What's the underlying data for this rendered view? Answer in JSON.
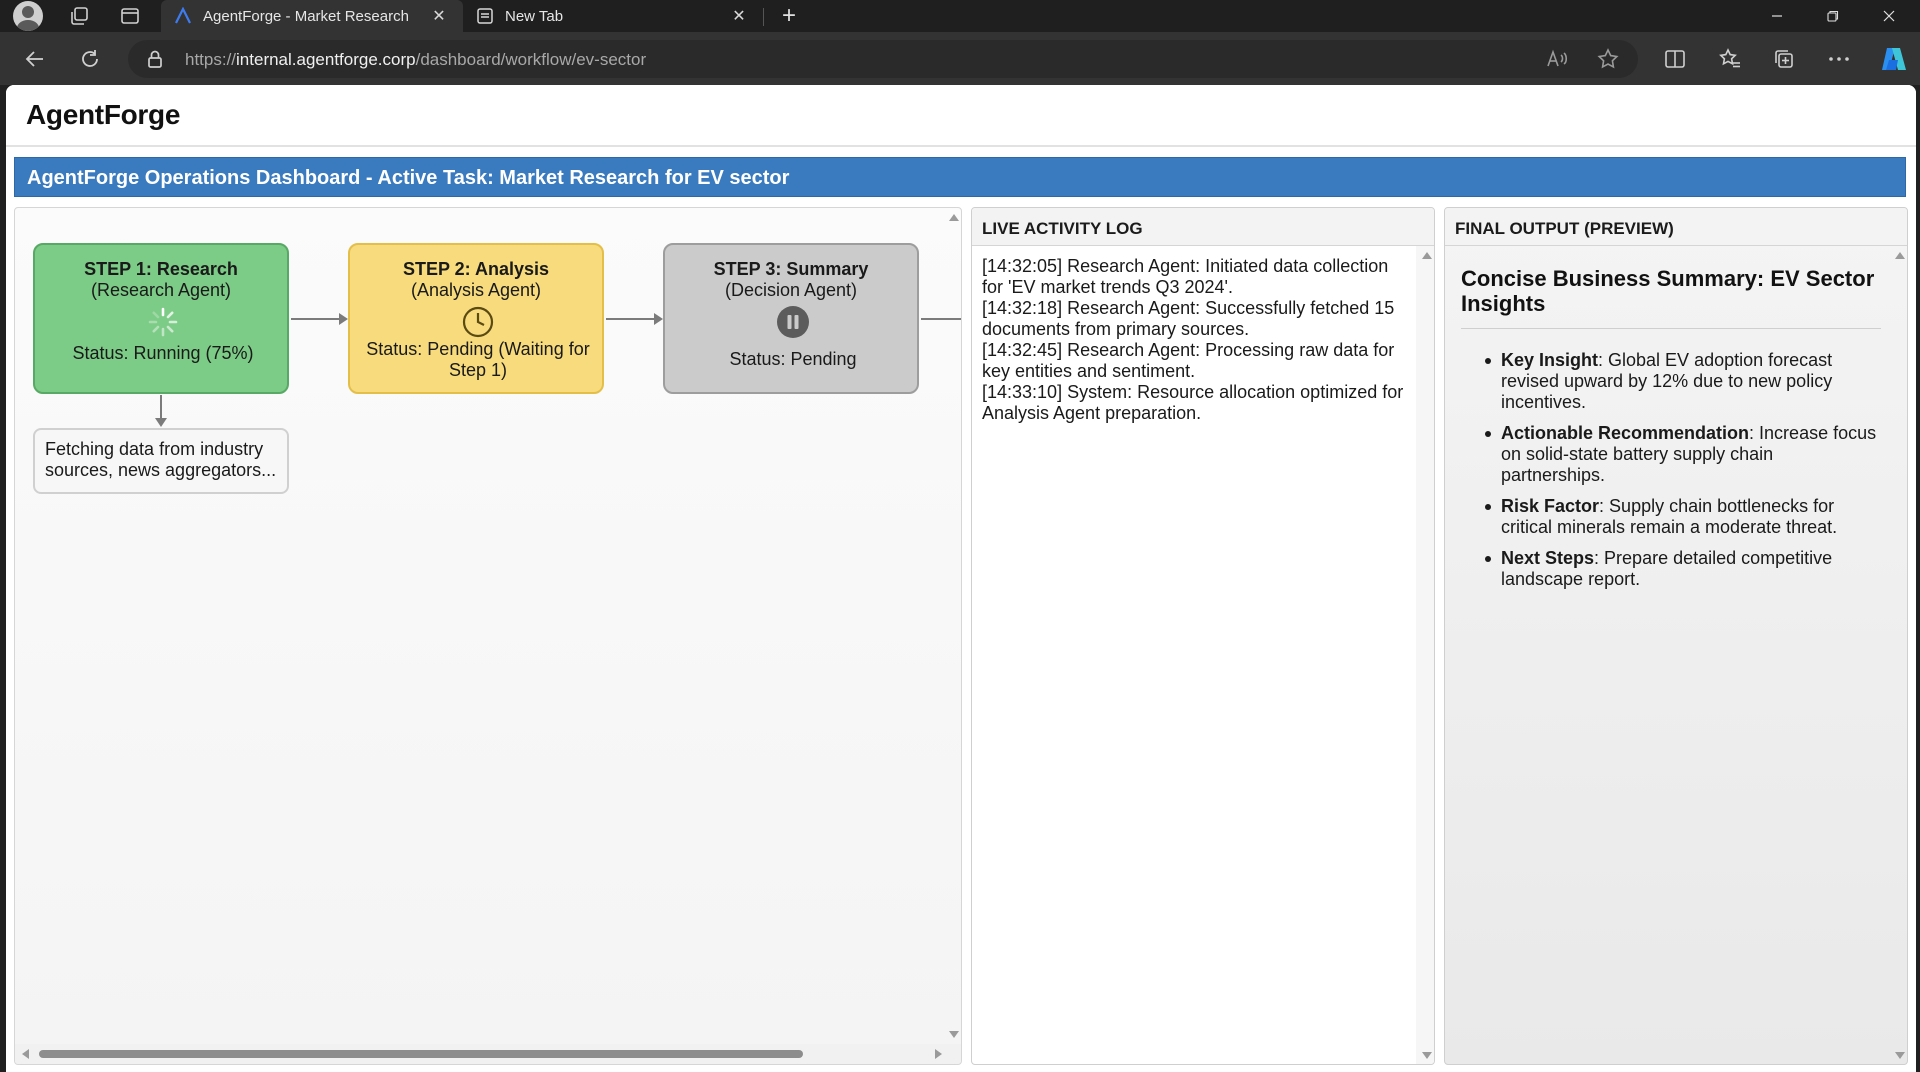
{
  "browser": {
    "tabs": [
      {
        "title": "AgentForge - Market Research",
        "active": true
      },
      {
        "title": "New Tab",
        "active": false
      }
    ],
    "address": {
      "scheme": "https://",
      "host": "internal.agentforge.corp",
      "path": "/dashboard/workflow/ev-sector"
    }
  },
  "app": {
    "logo": "AgentForge",
    "banner": "AgentForge Operations Dashboard - Active Task: Market Research for EV sector"
  },
  "workflow": {
    "steps": [
      {
        "title": "STEP 1: Research",
        "agent": "(Research Agent)",
        "status": "Status: Running (75%)",
        "icon": "spinner-icon",
        "color": "#7ccb86"
      },
      {
        "title": "STEP 2: Analysis",
        "agent": "(Analysis Agent)",
        "status": "Status: Pending (Waiting for Step 1)",
        "icon": "clock-icon",
        "color": "#f7db7c"
      },
      {
        "title": "STEP 3: Summary",
        "agent": "(Decision Agent)",
        "status": "Status: Pending",
        "icon": "pause-icon",
        "color": "#cbcbcb"
      }
    ],
    "step1_note": "Fetching data from industry sources, news aggregators..."
  },
  "log": {
    "title": "LIVE ACTIVITY LOG",
    "entries": [
      "[14:32:05] Research Agent: Initiated data collection for 'EV market trends Q3 2024'.",
      "[14:32:18] Research Agent: Successfully fetched 15 documents from primary sources.",
      "[14:32:45] Research Agent: Processing raw data for key entities and sentiment.",
      "[14:33:10] System: Resource allocation optimized for Analysis Agent preparation."
    ]
  },
  "output": {
    "title": "FINAL OUTPUT (PREVIEW)",
    "heading": "Concise Business Summary: EV Sector Insights",
    "items": [
      {
        "label": "Key Insight",
        "text": ": Global EV adoption forecast revised upward by 12% due to new policy incentives."
      },
      {
        "label": "Actionable Recommendation",
        "text": ": Increase focus on solid-state battery supply chain partnerships."
      },
      {
        "label": "Risk Factor",
        "text": ": Supply chain bottlenecks for critical minerals remain a moderate threat."
      },
      {
        "label": "Next Steps",
        "text": ": Prepare detailed competitive landscape report."
      }
    ]
  },
  "colors": {
    "banner": "#3a7abf",
    "running": "#7ccb86",
    "pending": "#f7db7c",
    "idle": "#cbcbcb"
  }
}
